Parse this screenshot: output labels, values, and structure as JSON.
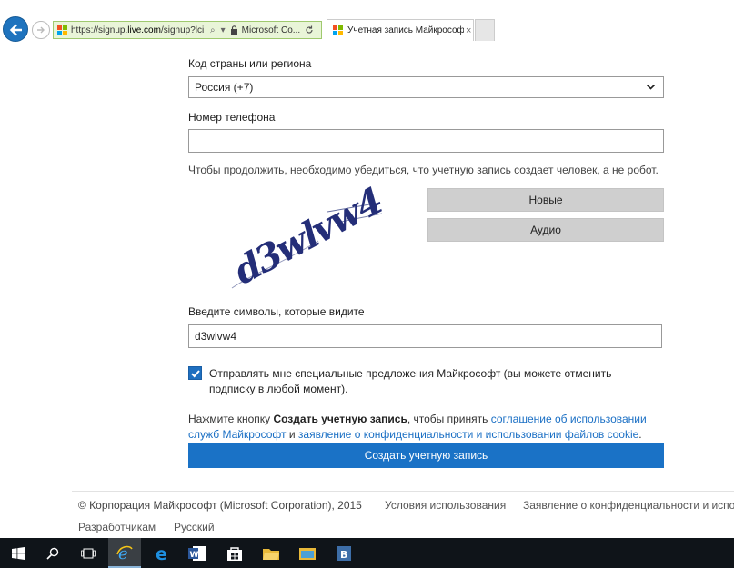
{
  "browser": {
    "address_url_prefix": "https://signup.",
    "address_url_domain": "live.com",
    "address_url_suffix": "/signup?lci",
    "search_glyph": "⌕",
    "dropdown_glyph": "▾",
    "cert_label": "Microsoft Co...",
    "tab_title": "Учетная запись Майкрософ...",
    "tab_close": "×"
  },
  "form": {
    "country_label": "Код страны или региона",
    "country_value": "Россия (+7)",
    "phone_label": "Номер телефона",
    "phone_value": "",
    "captcha_hint": "Чтобы продолжить, необходимо убедиться, что учетную запись создает человек, а не робот.",
    "new_button": "Новые",
    "audio_button": "Аудио",
    "captcha_text": "d3wlvw4",
    "chars_label": "Введите символы, которые видите",
    "chars_value": "d3wlvw4",
    "offers_checked": true,
    "offers_label": "Отправлять мне специальные предложения Майкрософт (вы можете отменить подписку в любой момент).",
    "terms_prefix": "Нажмите кнопку ",
    "terms_bold": "Создать учетную запись",
    "terms_middle": ", чтобы принять ",
    "terms_link1": "соглашение об использовании служб Майкрософт",
    "terms_and": " и ",
    "terms_link2": "заявление о конфиденциальности и использовании файлов cookie",
    "terms_end": ".",
    "create_button": "Создать учетную запись"
  },
  "footer": {
    "copyright": "© Корпорация Майкрософт (Microsoft Corporation), 2015",
    "terms_link": "Условия использования",
    "privacy_link": "Заявление о конфиденциальности и испо",
    "developers_link": "Разработчикам",
    "language_link": "Русский"
  },
  "colors": {
    "accent": "#1a72c6",
    "address_bar": "#e9f5d8",
    "taskbar": "#0f1419"
  },
  "taskbar": {
    "icons": [
      "windows-start-icon",
      "search-icon",
      "task-view-icon",
      "internet-explorer-icon",
      "edge-icon",
      "word-icon",
      "store-icon",
      "folder-icon",
      "file-explorer-icon",
      "app-b-icon"
    ],
    "app_b_letter": "B"
  }
}
